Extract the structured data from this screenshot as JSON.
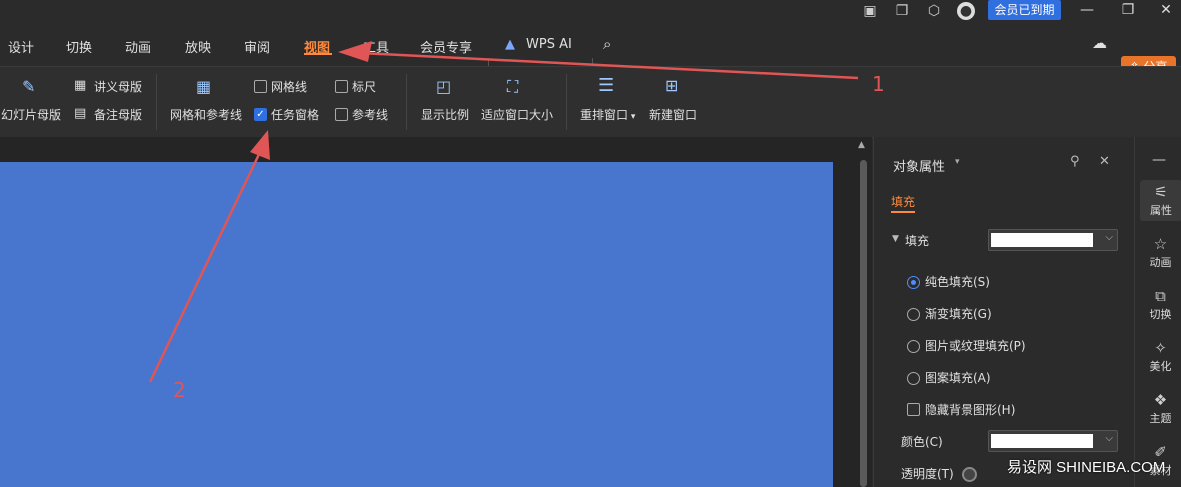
{
  "titlebar": {
    "member_label": "会员已到期",
    "icons": [
      "screenshot-icon",
      "window-icon",
      "cube-icon",
      "avatar"
    ]
  },
  "menu": {
    "items": [
      "设计",
      "切换",
      "动画",
      "放映",
      "审阅",
      "视图",
      "工具",
      "会员专享",
      "WPS AI"
    ],
    "active": "视图",
    "share_label": "分享"
  },
  "ribbon": {
    "slide_master": "幻灯片母版",
    "handout_master": "讲义母版",
    "notes_master": "备注母版",
    "grid_guides": "网格和参考线",
    "gridlines": "网格线",
    "ruler": "标尺",
    "task_pane": "任务窗格",
    "guides": "参考线",
    "zoom": "显示比例",
    "fit_window": "适应窗口大小",
    "arrange_windows": "重排窗口",
    "new_window": "新建窗口"
  },
  "panel": {
    "title": "对象属性",
    "tab_fill": "填充",
    "fill_section": "填充",
    "options": [
      {
        "label": "纯色填充(S)",
        "selected": true
      },
      {
        "label": "渐变填充(G)",
        "selected": false
      },
      {
        "label": "图片或纹理填充(P)",
        "selected": false
      },
      {
        "label": "图案填充(A)",
        "selected": false
      }
    ],
    "hide_bg": "隐藏背景图形(H)",
    "color_label": "颜色(C)",
    "transparency_label": "透明度(T)"
  },
  "rail": {
    "items": [
      "属性",
      "动画",
      "切换",
      "美化",
      "主题",
      "素材"
    ]
  },
  "annotations": {
    "label_1": "1",
    "label_2": "2"
  },
  "watermark": "易设网 SHINEIBA.COM",
  "colors": {
    "accent": "#ff8a3d",
    "slide": "#4876cf",
    "arrow": "#e05555",
    "member": "#2f6fe0"
  }
}
